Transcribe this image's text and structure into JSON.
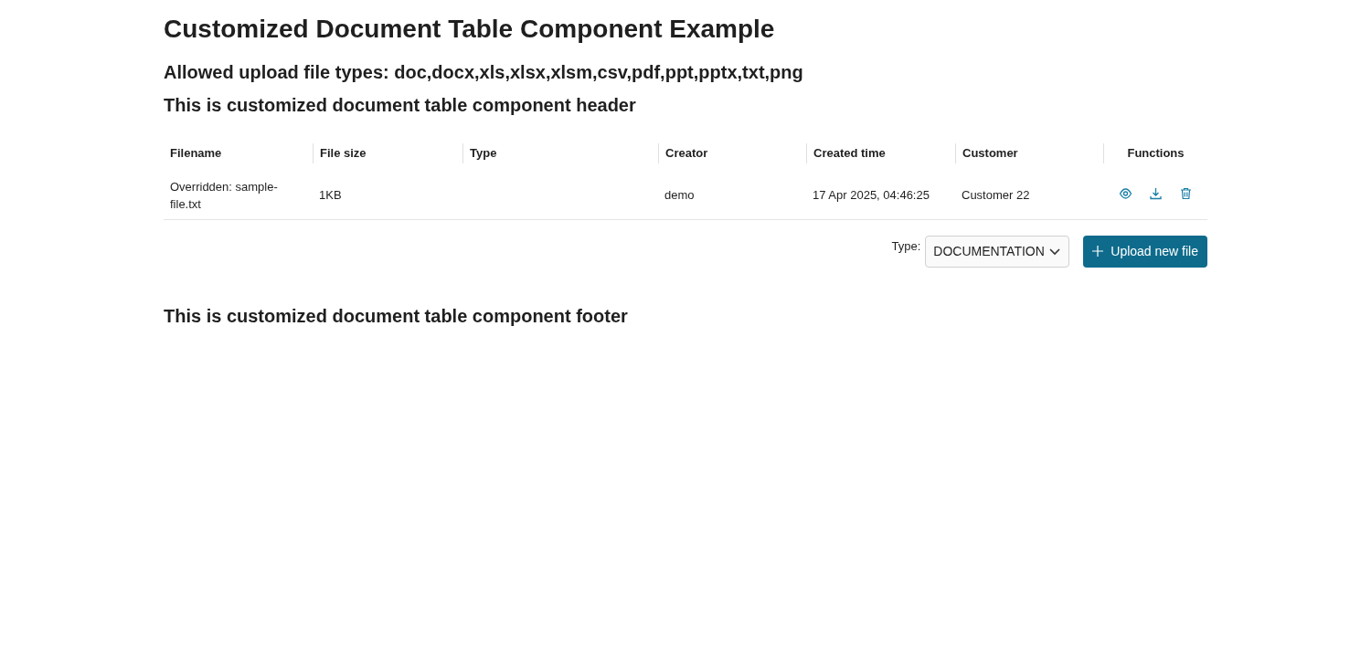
{
  "title": "Customized Document Table Component Example",
  "allowed_types": "Allowed upload file types: doc,docx,xls,xlsx,xlsm,csv,pdf,ppt,pptx,txt,png",
  "header": "This is customized document table component header",
  "table": {
    "columns": [
      "Filename",
      "File size",
      "Type",
      "Creator",
      "Created time",
      "Customer",
      "Functions"
    ],
    "rows": [
      {
        "filename": "Overridden: sample-file.txt",
        "file_size": "1KB",
        "creator": "demo",
        "created_time": "17 Apr 2025, 04:46:25",
        "customer": "Customer 22"
      }
    ]
  },
  "upload": {
    "type_label": "Type:",
    "type_value": "DOCUMENTATION",
    "button": "Upload new file"
  },
  "footer": "This is customized document table component footer"
}
